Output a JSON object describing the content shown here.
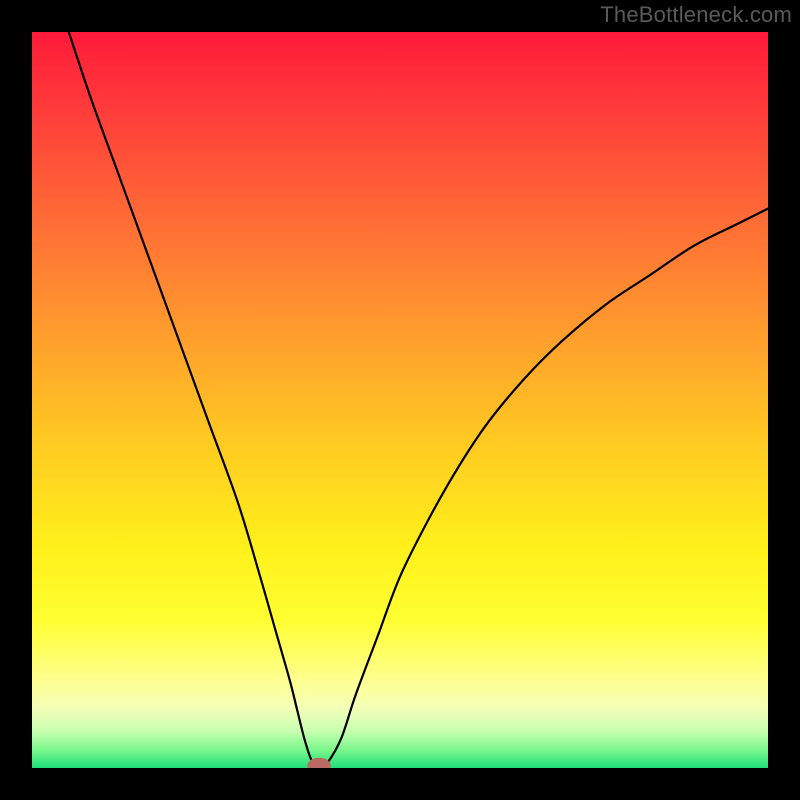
{
  "watermark": "TheBottleneck.com",
  "colors": {
    "frame": "#000000",
    "watermark": "#5a5a5a",
    "curve": "#000000",
    "marker_fill": "#b86b62",
    "gradient_stops": [
      {
        "offset": 0.0,
        "color": "#ff1a3a"
      },
      {
        "offset": 0.1,
        "color": "#ff3a3a"
      },
      {
        "offset": 0.25,
        "color": "#ff6a36"
      },
      {
        "offset": 0.4,
        "color": "#ff9a2e"
      },
      {
        "offset": 0.55,
        "color": "#ffc822"
      },
      {
        "offset": 0.7,
        "color": "#fff01a"
      },
      {
        "offset": 0.8,
        "color": "#ffff32"
      },
      {
        "offset": 0.88,
        "color": "#ffff90"
      },
      {
        "offset": 0.92,
        "color": "#f2ffb8"
      },
      {
        "offset": 0.95,
        "color": "#c8ffb0"
      },
      {
        "offset": 0.975,
        "color": "#7cf78c"
      },
      {
        "offset": 1.0,
        "color": "#20e07a"
      }
    ]
  },
  "chart_data": {
    "type": "line",
    "title": "",
    "xlabel": "",
    "ylabel": "",
    "xlim": [
      0,
      100
    ],
    "ylim": [
      0,
      100
    ],
    "grid": false,
    "legend": false,
    "series": [
      {
        "name": "bottleneck-curve",
        "x": [
          5,
          8,
          12,
          16,
          20,
          24,
          28,
          31,
          33,
          35,
          36,
          37,
          38,
          39,
          40,
          42,
          44,
          47,
          50,
          54,
          58,
          62,
          67,
          72,
          78,
          84,
          90,
          96,
          100
        ],
        "y": [
          100,
          91,
          80,
          69,
          58,
          47,
          36,
          26,
          19,
          12,
          8,
          4,
          1,
          0,
          0.5,
          4,
          10,
          18,
          26,
          34,
          41,
          47,
          53,
          58,
          63,
          67,
          71,
          74,
          76
        ]
      }
    ],
    "marker": {
      "x": 39,
      "y": 0.3,
      "rx": 1.6,
      "ry": 1.1
    }
  }
}
